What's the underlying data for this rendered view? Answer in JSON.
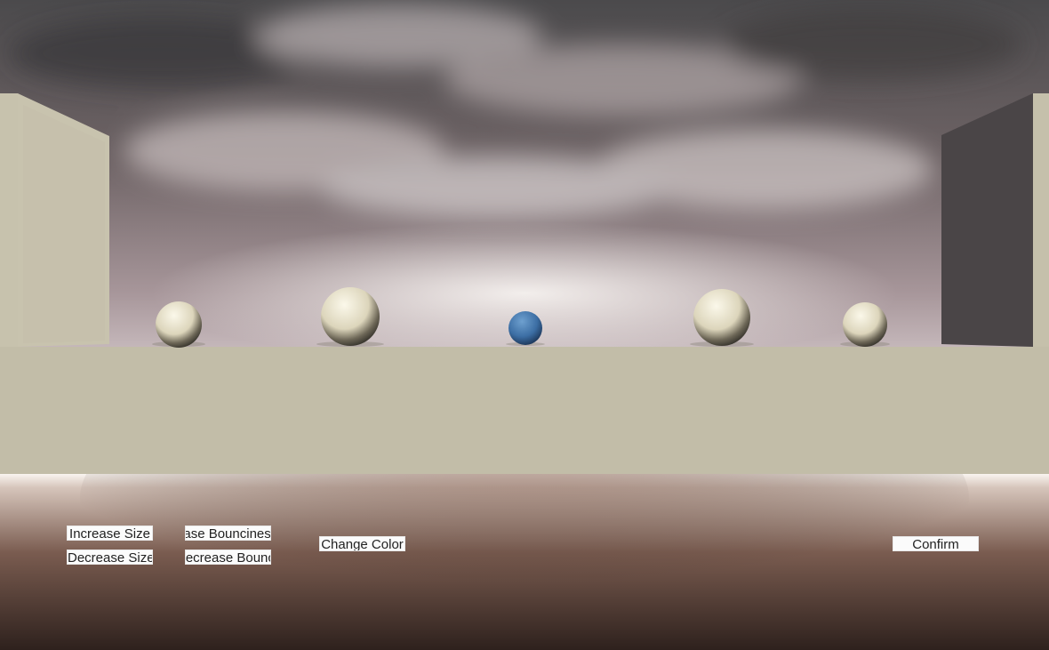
{
  "controls": {
    "increase_size": "Increase Size",
    "decrease_size": "Decrease Size",
    "increase_bounciness": "Increase Bounciness",
    "decrease_bounciness": "Decrease Bounciness",
    "change_color": "Change Color",
    "confirm": "Confirm"
  },
  "colors": {
    "floor": "#c2bda8",
    "selected_ball": "#3c6ea4",
    "ball": "#e6e0c8"
  }
}
